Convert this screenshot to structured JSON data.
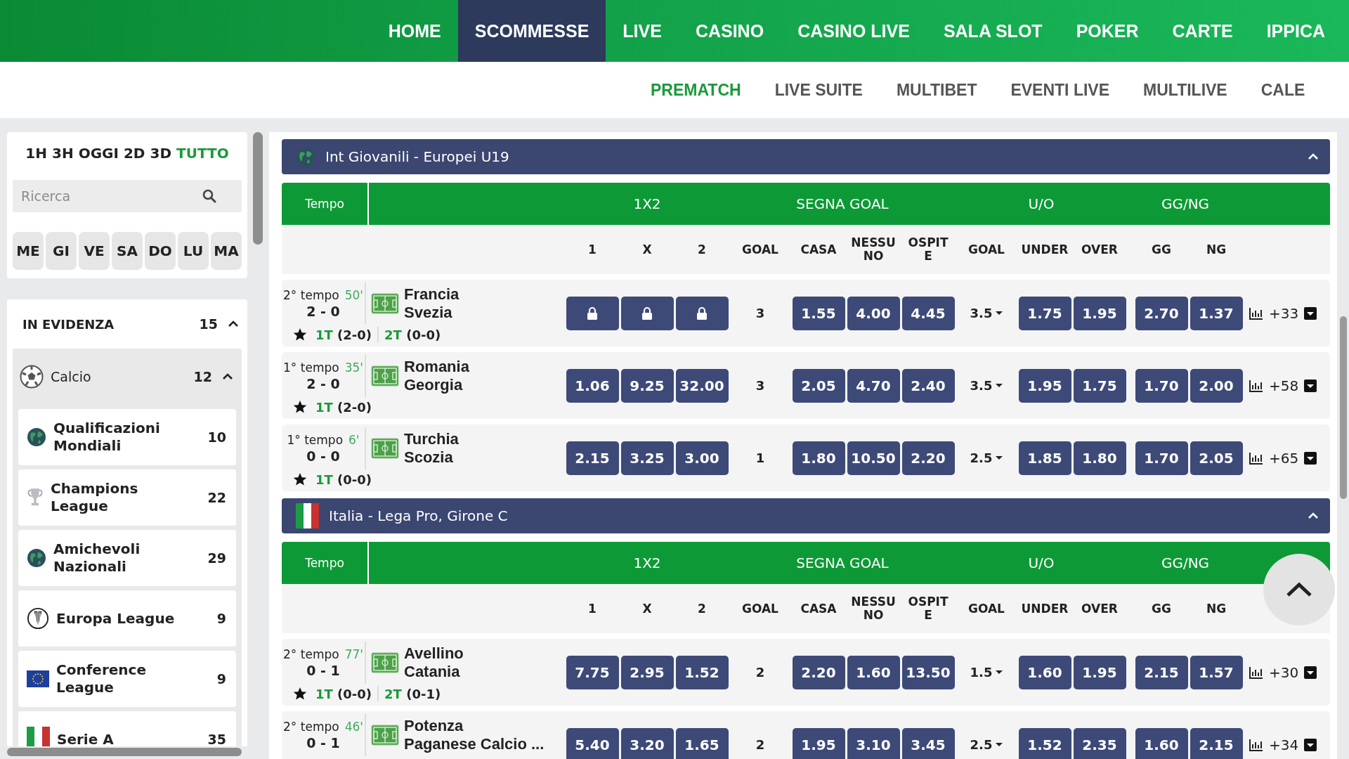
{
  "top_nav": [
    {
      "label": "HOME",
      "selected": false
    },
    {
      "label": "SCOMMESSE",
      "selected": true
    },
    {
      "label": "LIVE",
      "selected": false
    },
    {
      "label": "CASINO",
      "selected": false
    },
    {
      "label": "CASINO LIVE",
      "selected": false
    },
    {
      "label": "SALA SLOT",
      "selected": false
    },
    {
      "label": "POKER",
      "selected": false
    },
    {
      "label": "CARTE",
      "selected": false
    },
    {
      "label": "IPPICA",
      "selected": false
    }
  ],
  "sub_nav": [
    {
      "label": "PREMATCH",
      "selected": true
    },
    {
      "label": "LIVE SUITE",
      "selected": false
    },
    {
      "label": "MULTIBET",
      "selected": false
    },
    {
      "label": "EVENTI LIVE",
      "selected": false
    },
    {
      "label": "MULTILIVE",
      "selected": false
    },
    {
      "label": "CALE",
      "selected": false
    }
  ],
  "sidebar": {
    "time_filters": [
      {
        "label": "1H",
        "selected": false
      },
      {
        "label": "3H",
        "selected": false
      },
      {
        "label": "OGGI",
        "selected": false
      },
      {
        "label": "2D",
        "selected": false
      },
      {
        "label": "3D",
        "selected": false
      },
      {
        "label": "TUTTO",
        "selected": true
      }
    ],
    "search": {
      "placeholder": "Ricerca"
    },
    "days": [
      "ME",
      "GI",
      "VE",
      "SA",
      "DO",
      "LU",
      "MA"
    ],
    "featured": {
      "title": "IN EVIDENZA",
      "count": "15",
      "expanded": true,
      "sport": {
        "name": "Calcio",
        "count": "12",
        "expanded": true,
        "leagues": [
          {
            "name": "Qualificazioni Mondiali",
            "count": "10",
            "kind": "globe"
          },
          {
            "name": "Champions League",
            "count": "22",
            "kind": "trophy"
          },
          {
            "name": "Amichevoli Nazionali",
            "count": "29",
            "kind": "globe"
          },
          {
            "name": "Europa League",
            "count": "9",
            "kind": "europa"
          },
          {
            "name": "Conference League",
            "count": "9",
            "kind": "eu-flag"
          },
          {
            "name": "Serie A",
            "count": "35",
            "kind": "italy-flag"
          }
        ]
      }
    }
  },
  "sections": [
    {
      "title": "Int Giovanili - Europei U19",
      "kind": "globe",
      "expanded": true,
      "header": {
        "tempo": "Tempo",
        "groups": [
          "1X2",
          "SEGNA GOAL",
          "U/O",
          "GG/NG"
        ],
        "columns": [
          {
            "label": "1",
            "kind": "normal"
          },
          {
            "label": "X",
            "kind": "normal"
          },
          {
            "label": "2",
            "kind": "normal"
          },
          {
            "label": "GOAL",
            "kind": "normal"
          },
          {
            "label": "CASA",
            "kind": "normal"
          },
          {
            "label": "NESSUNO",
            "kind": "narrow"
          },
          {
            "label": "OSPITE",
            "kind": "narrow"
          },
          {
            "label": "GOAL",
            "kind": "normal"
          },
          {
            "label": "UNDER",
            "kind": "normal"
          },
          {
            "label": "OVER",
            "kind": "normal"
          },
          {
            "label": "GG",
            "kind": "normal"
          },
          {
            "label": "NG",
            "kind": "normal"
          }
        ]
      },
      "matches": [
        {
          "period": "2° tempo",
          "minute": "50'",
          "score": "2 - 0",
          "home": "Francia",
          "away": "Svezia",
          "halves": [
            {
              "label": "1T",
              "score": "(2-0)"
            },
            {
              "label": "2T",
              "score": "(0-0)"
            }
          ],
          "result": [
            {
              "locked": true
            },
            {
              "locked": true
            },
            {
              "locked": true
            }
          ],
          "goal": "3",
          "score_goal": [
            "1.55",
            "4.00",
            "4.45"
          ],
          "line": "3.5",
          "under_over": [
            "1.75",
            "1.95"
          ],
          "gg_ng": [
            "2.70",
            "1.37"
          ],
          "more": "+33"
        },
        {
          "period": "1° tempo",
          "minute": "35'",
          "score": "2 - 0",
          "home": "Romania",
          "away": "Georgia",
          "halves": [
            {
              "label": "1T",
              "score": "(2-0)"
            }
          ],
          "result": [
            {
              "odd": "1.06",
              "locked": false
            },
            {
              "odd": "9.25",
              "locked": false
            },
            {
              "odd": "32.00",
              "locked": false
            }
          ],
          "goal": "3",
          "score_goal": [
            "2.05",
            "4.70",
            "2.40"
          ],
          "line": "3.5",
          "under_over": [
            "1.95",
            "1.75"
          ],
          "gg_ng": [
            "1.70",
            "2.00"
          ],
          "more": "+58"
        },
        {
          "period": "1° tempo",
          "minute": "6'",
          "score": "0 - 0",
          "home": "Turchia",
          "away": "Scozia",
          "halves": [
            {
              "label": "1T",
              "score": "(0-0)"
            }
          ],
          "result": [
            {
              "odd": "2.15",
              "locked": false
            },
            {
              "odd": "3.25",
              "locked": false
            },
            {
              "odd": "3.00",
              "locked": false
            }
          ],
          "goal": "1",
          "score_goal": [
            "1.80",
            "10.50",
            "2.20"
          ],
          "line": "2.5",
          "under_over": [
            "1.85",
            "1.80"
          ],
          "gg_ng": [
            "1.70",
            "2.05"
          ],
          "more": "+65"
        }
      ]
    },
    {
      "title": "Italia - Lega Pro, Girone C",
      "kind": "italy-flag",
      "expanded": true,
      "header": {
        "tempo": "Tempo",
        "groups": [
          "1X2",
          "SEGNA GOAL",
          "U/O",
          "GG/NG"
        ],
        "columns": [
          {
            "label": "1",
            "kind": "normal"
          },
          {
            "label": "X",
            "kind": "normal"
          },
          {
            "label": "2",
            "kind": "normal"
          },
          {
            "label": "GOAL",
            "kind": "normal"
          },
          {
            "label": "CASA",
            "kind": "normal"
          },
          {
            "label": "NESSUNO",
            "kind": "narrow"
          },
          {
            "label": "OSPITE",
            "kind": "narrow"
          },
          {
            "label": "GOAL",
            "kind": "normal"
          },
          {
            "label": "UNDER",
            "kind": "normal"
          },
          {
            "label": "OVER",
            "kind": "normal"
          },
          {
            "label": "GG",
            "kind": "normal"
          },
          {
            "label": "NG",
            "kind": "normal"
          }
        ]
      },
      "matches": [
        {
          "period": "2° tempo",
          "minute": "77'",
          "score": "0 - 1",
          "home": "Avellino",
          "away": "Catania",
          "halves": [
            {
              "label": "1T",
              "score": "(0-0)"
            },
            {
              "label": "2T",
              "score": "(0-1)"
            }
          ],
          "result": [
            {
              "odd": "7.75",
              "locked": false
            },
            {
              "odd": "2.95",
              "locked": false
            },
            {
              "odd": "1.52",
              "locked": false
            }
          ],
          "goal": "2",
          "score_goal": [
            "2.20",
            "1.60",
            "13.50"
          ],
          "line": "1.5",
          "under_over": [
            "1.60",
            "1.95"
          ],
          "gg_ng": [
            "2.15",
            "1.57"
          ],
          "more": "+30"
        },
        {
          "period": "2° tempo",
          "minute": "46'",
          "score": "0 - 1",
          "home": "Potenza",
          "away": "Paganese Calcio ...",
          "result": [
            {
              "odd": "5.40",
              "locked": false
            },
            {
              "odd": "3.20",
              "locked": false
            },
            {
              "odd": "1.65",
              "locked": false
            }
          ],
          "goal": "2",
          "score_goal": [
            "1.95",
            "3.10",
            "3.45"
          ],
          "line": "2.5",
          "under_over": [
            "1.52",
            "2.35"
          ],
          "gg_ng": [
            "1.60",
            "2.15"
          ],
          "more": "+34"
        }
      ]
    }
  ]
}
